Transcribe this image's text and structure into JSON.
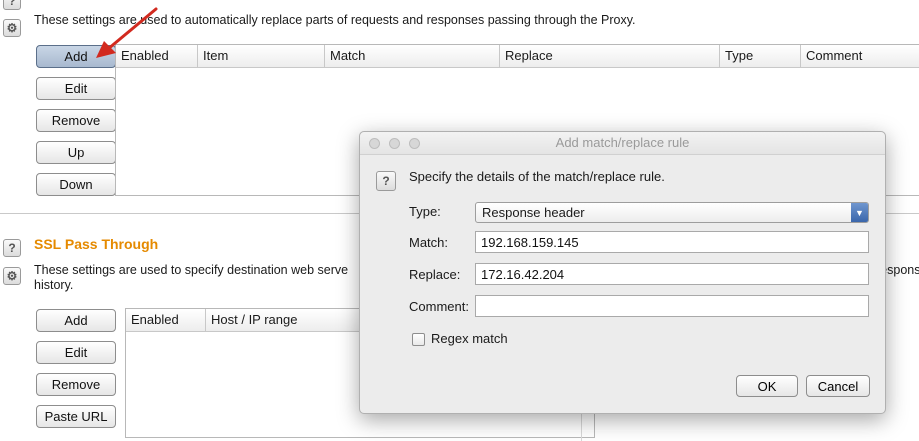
{
  "match_replace": {
    "description": "These settings are used to automatically replace parts of requests and responses passing through the Proxy.",
    "buttons": {
      "add": "Add",
      "edit": "Edit",
      "remove": "Remove",
      "up": "Up",
      "down": "Down"
    },
    "columns": [
      "Enabled",
      "Item",
      "Match",
      "Replace",
      "Type",
      "Comment"
    ]
  },
  "ssl_pass_through": {
    "title": "SSL Pass Through",
    "description_line1": "These settings are used to specify destination web serve",
    "description_line1_tail": "respons",
    "description_line2": "history.",
    "buttons": {
      "add": "Add",
      "edit": "Edit",
      "remove": "Remove",
      "paste_url": "Paste URL"
    },
    "columns": [
      "Enabled",
      "Host / IP range"
    ]
  },
  "dialog": {
    "title": "Add match/replace rule",
    "help_text": "Specify the details of the match/replace rule.",
    "type_label": "Type:",
    "type_value": "Response header",
    "match_label": "Match:",
    "match_value": "192.168.159.145",
    "replace_label": "Replace:",
    "replace_value": "172.16.42.204",
    "comment_label": "Comment:",
    "comment_value": "",
    "regex_label": "Regex match",
    "regex_checked": false,
    "ok_label": "OK",
    "cancel_label": "Cancel"
  },
  "icons": {
    "help": "?",
    "settings": "⚙"
  },
  "colors": {
    "section_title": "#e58a00",
    "arrow": "#d22a1f",
    "select_accent": "#3a66ab"
  }
}
